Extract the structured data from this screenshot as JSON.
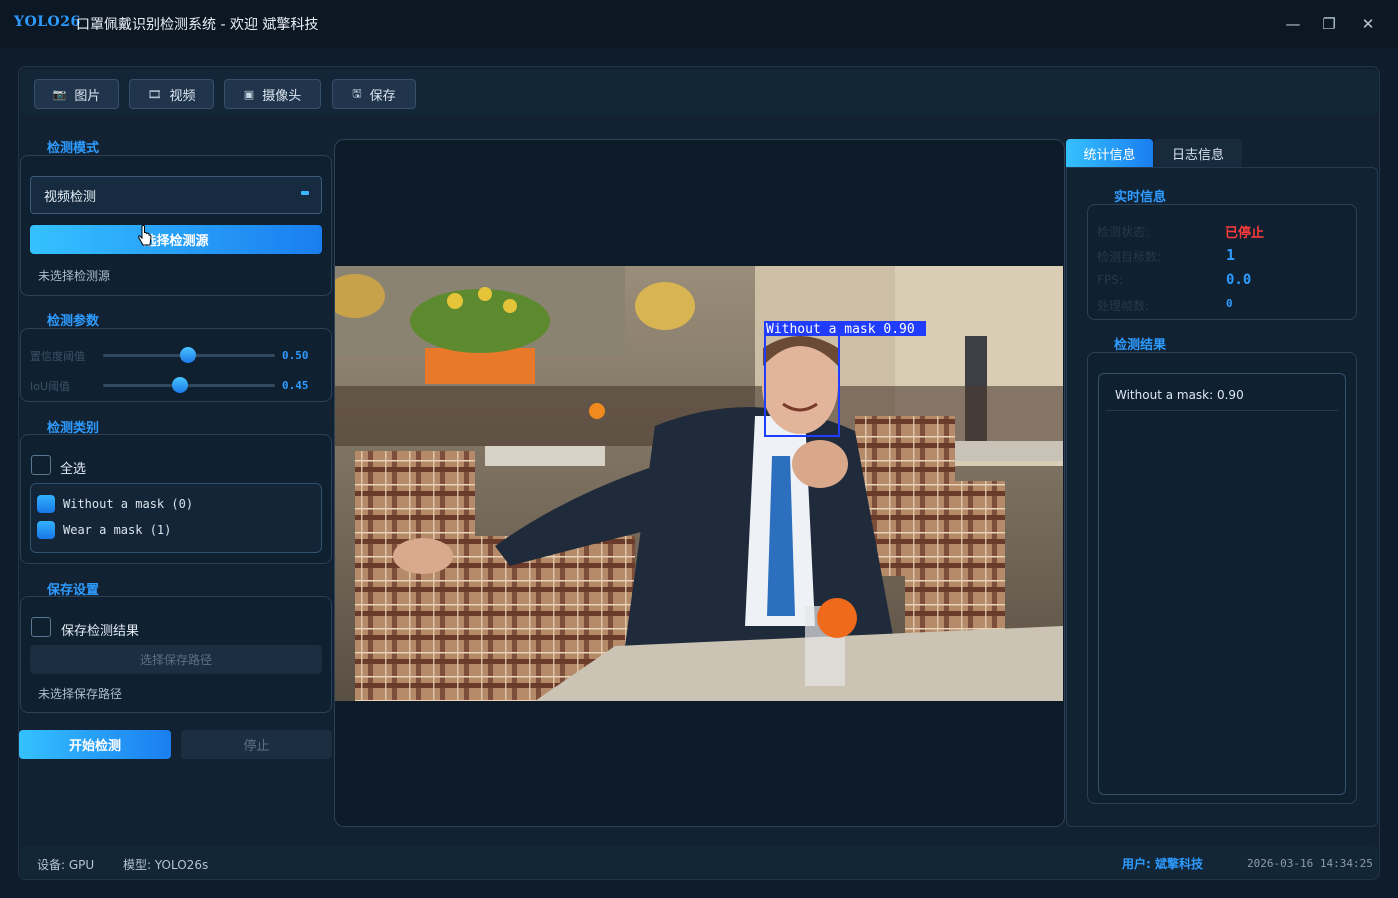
{
  "titlebar": {
    "logo": "YOLO26",
    "title": "口罩佩戴识别检测系统 - 欢迎 斌擎科技",
    "minimize": "—",
    "maximize": "❐",
    "close": "✕"
  },
  "toolbar": {
    "buttons": [
      {
        "label": "图片",
        "icon": "camera-icon"
      },
      {
        "label": "视频",
        "icon": "film-icon"
      },
      {
        "label": "摄像头",
        "icon": "webcam-icon"
      },
      {
        "label": "保存",
        "icon": "save-icon"
      }
    ]
  },
  "left": {
    "mode": {
      "title": "检测模式",
      "selected": "视频检测",
      "select_source": "选择检测源",
      "source_status": "未选择检测源"
    },
    "params": {
      "title": "检测参数",
      "confidence_label": "置信度阈值",
      "confidence_value": "0.50",
      "iou_label": "IoU阈值",
      "iou_value": "0.45"
    },
    "classes": {
      "title": "检测类别",
      "select_all": "全选",
      "items": [
        "Without a mask (0)",
        "Wear a mask (1)"
      ]
    },
    "save": {
      "title": "保存设置",
      "save_results": "保存检测结果",
      "choose_path": "选择保存路径",
      "path_status": "未选择保存路径"
    },
    "start": "开始检测",
    "stop": "停止"
  },
  "video": {
    "detection_label": "Without a mask 0.90"
  },
  "right": {
    "tabs": [
      "统计信息",
      "日志信息"
    ],
    "realtime": {
      "title": "实时信息",
      "rows": [
        {
          "label": "检测状态:",
          "value": "已停止"
        },
        {
          "label": "检测目标数:",
          "value": "1"
        },
        {
          "label": "FPS:",
          "value": "0.0"
        },
        {
          "label": "处理帧数:",
          "value": "0"
        }
      ]
    },
    "results": {
      "title": "检测结果",
      "items": [
        "Without a mask: 0.90"
      ]
    }
  },
  "statusbar": {
    "device": "设备: GPU",
    "model": "模型: YOLO26s",
    "user": "用户: 斌擎科技",
    "datetime": "2026-03-16 14:34:25"
  },
  "colors": {
    "accent": "#2e9bff",
    "stopped": "#ff3b3b"
  }
}
